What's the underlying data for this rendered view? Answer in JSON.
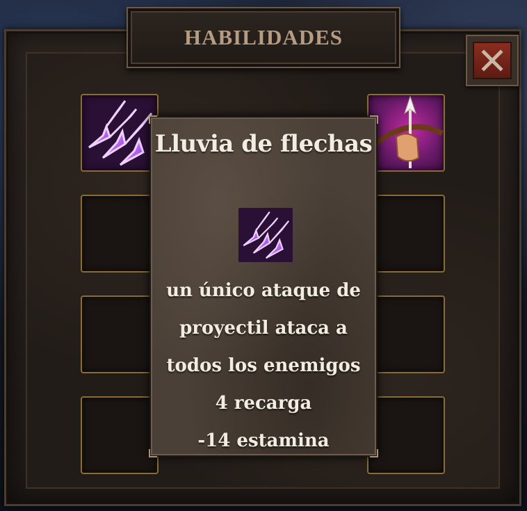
{
  "header": {
    "title": "HABILIDADES"
  },
  "close_icon": "close-x-icon",
  "slots": {
    "left": [
      {
        "state": "filled",
        "icon": "arrow-rain-icon"
      },
      {
        "state": "empty"
      },
      {
        "state": "empty"
      },
      {
        "state": "empty"
      }
    ],
    "right": [
      {
        "state": "filled",
        "icon": "bow-shot-icon"
      },
      {
        "state": "empty"
      },
      {
        "state": "empty"
      },
      {
        "state": "empty"
      }
    ]
  },
  "tooltip": {
    "title": "Lluvia de flechas",
    "icon": "arrow-rain-icon",
    "description_lines": [
      "un único ataque de",
      "proyectil ataca a",
      "todos los enemigos"
    ],
    "cooldown": "4 recarga",
    "cost": "-14 estamina"
  },
  "colors": {
    "slot_border": "#8a6d36",
    "close_button": "#8a2d1f",
    "title_text": "#b59c82",
    "tooltip_bg": "#4b4037",
    "arrow_glow": "#b04bff"
  }
}
